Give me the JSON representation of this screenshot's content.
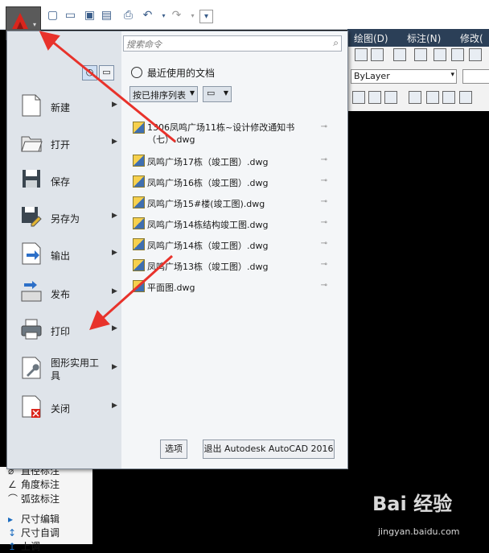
{
  "ribbon": {
    "tabs": [
      "绘图(D)",
      "标注(N)",
      "修改("
    ],
    "layer_value": "ByLayer"
  },
  "search": {
    "placeholder": "搜索命令"
  },
  "menu": {
    "items": [
      {
        "label": "新建",
        "icon": "new-file-icon"
      },
      {
        "label": "打开",
        "icon": "folder-open-icon"
      },
      {
        "label": "保存",
        "icon": "save-icon"
      },
      {
        "label": "另存为",
        "icon": "save-as-icon"
      },
      {
        "label": "输出",
        "icon": "export-icon"
      },
      {
        "label": "发布",
        "icon": "publish-icon"
      },
      {
        "label": "打印",
        "icon": "printer-icon"
      },
      {
        "label": "图形实用工具",
        "icon": "wrench-icon"
      },
      {
        "label": "关闭",
        "icon": "close-file-icon"
      }
    ]
  },
  "recent": {
    "title": "最近使用的文档",
    "sort": "按已排序列表",
    "files": [
      "1306凤鸣广场11栋~设计修改通知书（七）.dwg",
      "凤鸣广场17栋（竣工图）.dwg",
      "凤鸣广场16栋（竣工图）.dwg",
      "凤鸣广场15#楼(竣工图).dwg",
      "凤鸣广场14栋结构竣工图.dwg",
      "凤鸣广场14栋（竣工图）.dwg",
      "凤鸣广场13栋（竣工图）.dwg",
      "平面图.dwg"
    ]
  },
  "footer": {
    "options": "选项",
    "exit": "退出 Autodesk AutoCAD 2016"
  },
  "palette": {
    "items": [
      "直径标注",
      "角度标注",
      "弧弦标注",
      "尺寸编辑",
      "尺寸自调",
      "上调"
    ]
  },
  "watermark": {
    "logo": "Bai 经验",
    "url": "jingyan.baidu.com"
  },
  "colors": {
    "arrow": "#e8322b",
    "logo": "#d9251c"
  }
}
